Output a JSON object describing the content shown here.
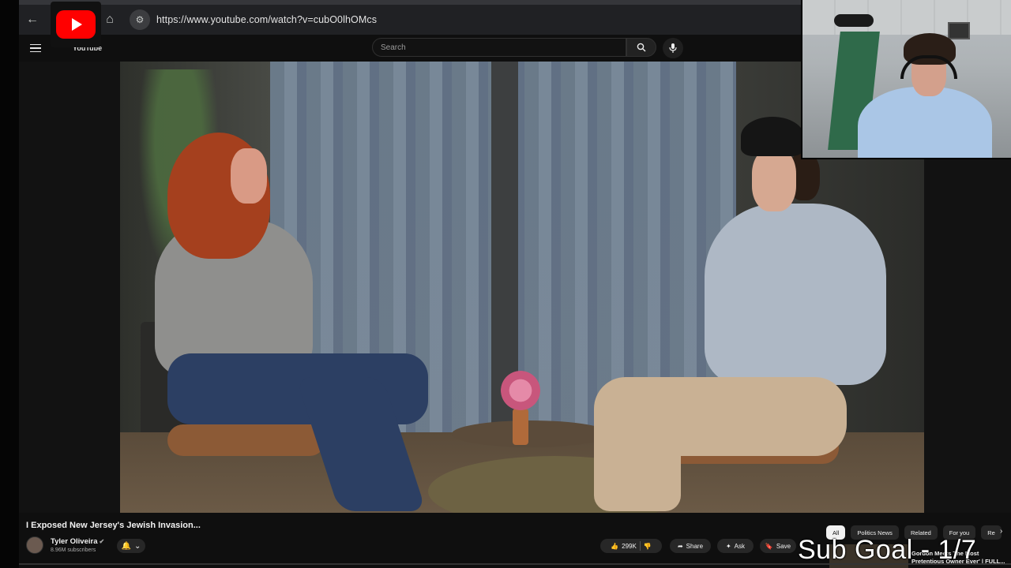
{
  "browser": {
    "url": "https://www.youtube.com/watch?v=cubO0lhOMcs",
    "back_icon": "arrow-left-icon",
    "home_icon": "home-icon",
    "site_info_icon": "tune-icon"
  },
  "youtube_header": {
    "wordmark": "YouTube",
    "search_placeholder": "Search",
    "search_icon": "search-icon",
    "mic_icon": "mic-icon"
  },
  "video": {
    "title": "I Exposed New Jersey's Jewish Invasion...",
    "channel": "Tyler Oliveira",
    "subscribers": "8.96M subscribers",
    "likes": "299K",
    "actions": {
      "share": "Share",
      "ask": "Ask",
      "save": "Save"
    }
  },
  "chips": [
    "All",
    "Politics News",
    "Related",
    "For you",
    "Re"
  ],
  "recommendation": {
    "title": "Gordon Meets The Most Pretentious Owner Ever' | FULL..."
  },
  "overlay": {
    "sub_goal": "Sub Goal - 1/7"
  },
  "colors": {
    "brand_red": "#ff0000",
    "background": "#0f0f0f",
    "chip_bg": "#272727"
  }
}
